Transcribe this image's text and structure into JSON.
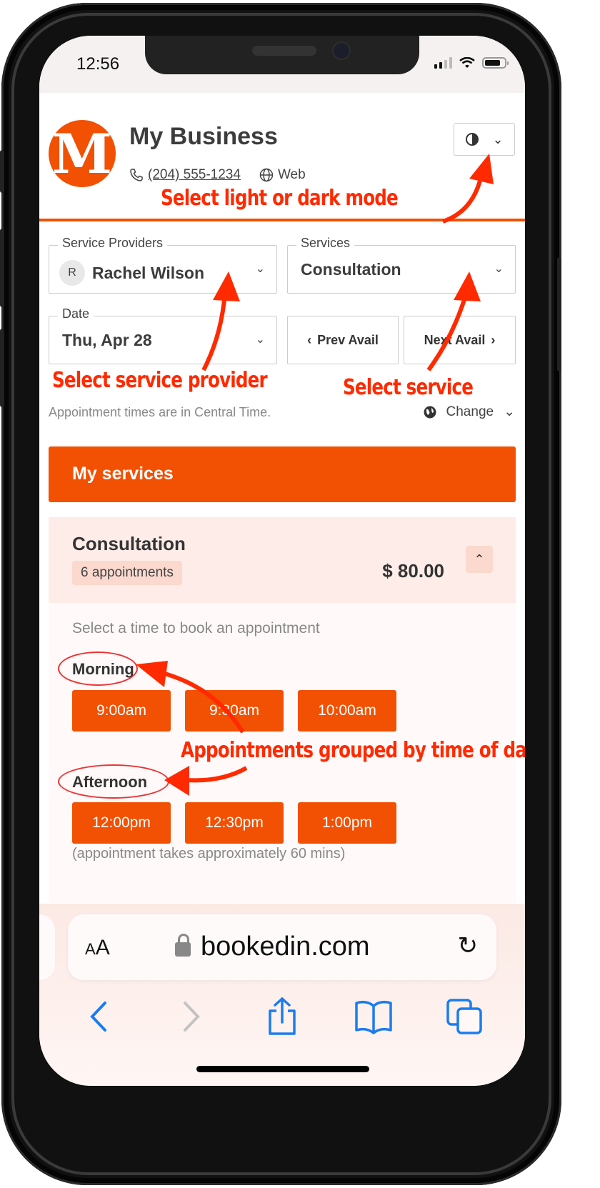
{
  "status_bar": {
    "time": "12:56"
  },
  "header": {
    "logo_letter": "M",
    "business_name": "My Business",
    "phone": "(204) 555-1234",
    "web_label": "Web",
    "theme_toggle": {
      "icon": "contrast-icon",
      "chevron": "⌄"
    }
  },
  "filters": {
    "service_providers": {
      "label": "Service Providers",
      "avatar_initial": "R",
      "value": "Rachel Wilson"
    },
    "services": {
      "label": "Services",
      "value": "Consultation"
    },
    "date": {
      "label": "Date",
      "value": "Thu, Apr 28"
    },
    "prev_avail": "Prev Avail",
    "next_avail": "Next Avail"
  },
  "timezone": {
    "note": "Appointment times are in Central Time.",
    "change_label": "Change"
  },
  "services_section": {
    "title": "My services",
    "service": {
      "name": "Consultation",
      "appointments_badge": "6 appointments",
      "price": "$ 80.00",
      "expanded": true,
      "instruction": "Select a time to book an appointment",
      "groups": [
        {
          "label": "Morning",
          "slots": [
            "9:00am",
            "9:30am",
            "10:00am"
          ]
        },
        {
          "label": "Afternoon",
          "slots": [
            "12:00pm",
            "12:30pm",
            "1:00pm"
          ]
        }
      ],
      "duration_note": "(appointment takes approximately 60 mins)"
    }
  },
  "annotations": {
    "theme": "Select light or dark mode",
    "provider": "Select service provider",
    "service": "Select service",
    "grouping": "Appointments grouped by time of day"
  },
  "browser": {
    "text_size_label": "AA",
    "url": "bookedin.com",
    "toolbar": [
      "back-icon",
      "forward-icon",
      "share-icon",
      "bookmarks-icon",
      "tabs-icon"
    ]
  },
  "colors": {
    "brand": "#f25002",
    "annotation": "#ff2a00",
    "ios_blue": "#1a7cf0"
  }
}
